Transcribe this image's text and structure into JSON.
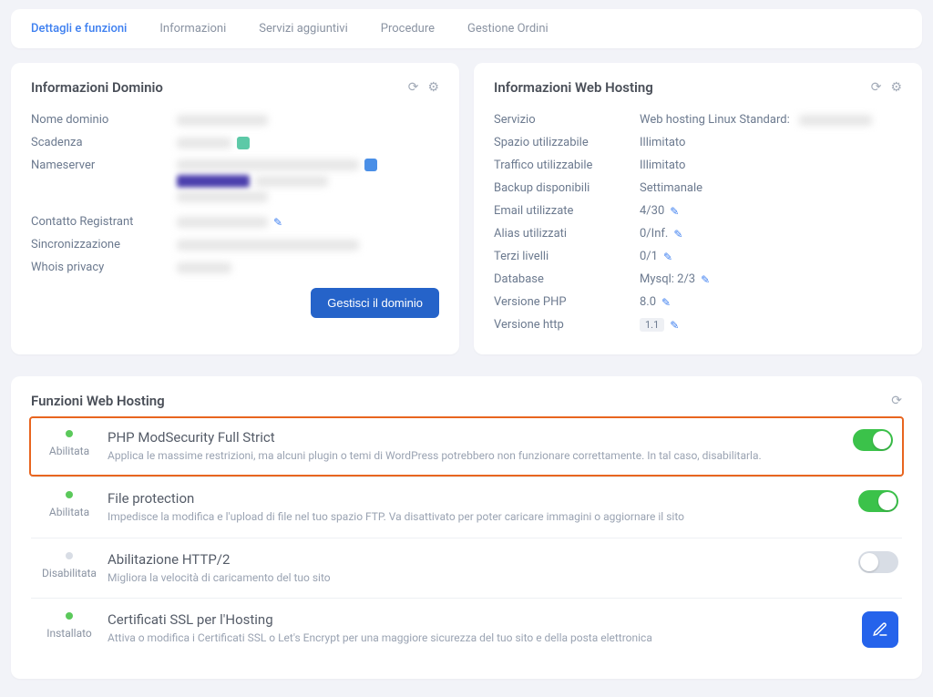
{
  "tabs": {
    "details": "Dettagli e funzioni",
    "info": "Informazioni",
    "addons": "Servizi aggiuntivi",
    "procedures": "Procedure",
    "orders": "Gestione Ordini"
  },
  "domainCard": {
    "title": "Informazioni Dominio",
    "rows": {
      "name_label": "Nome dominio",
      "expiry_label": "Scadenza",
      "ns_label": "Nameserver",
      "contact_label": "Contatto Registrant",
      "sync_label": "Sincronizzazione",
      "whois_label": "Whois privacy"
    },
    "button": "Gestisci il dominio"
  },
  "hostingCard": {
    "title": "Informazioni Web Hosting",
    "rows": {
      "service_label": "Servizio",
      "service_value": "Web hosting Linux Standard:",
      "space_label": "Spazio utilizzabile",
      "space_value": "Illimitato",
      "traffic_label": "Traffico utilizzabile",
      "traffic_value": "Illimitato",
      "backup_label": "Backup disponibili",
      "backup_value": "Settimanale",
      "email_label": "Email utilizzate",
      "email_value": "4/30",
      "alias_label": "Alias utilizzati",
      "alias_value": "0/Inf.",
      "sub_label": "Terzi livelli",
      "sub_value": "0/1",
      "db_label": "Database",
      "db_value": "Mysql: 2/3",
      "php_label": "Versione PHP",
      "php_value": "8.0",
      "http_label": "Versione http",
      "http_value": "1.1"
    }
  },
  "functionsCard": {
    "title": "Funzioni Web Hosting",
    "status_enabled": "Abilitata",
    "status_disabled": "Disabilitata",
    "status_installed": "Installato",
    "features": {
      "modsec": {
        "title": "PHP ModSecurity Full Strict",
        "desc": "Applica le massime restrizioni, ma alcuni plugin o temi di WordPress potrebbero non funzionare correttamente. In tal caso, disabilitarla."
      },
      "fileprot": {
        "title": "File protection",
        "desc": "Impedisce la modifica e l'upload di file nel tuo spazio FTP. Va disattivato per poter caricare immagini o aggiornare il sito"
      },
      "http2": {
        "title": "Abilitazione HTTP/2",
        "desc": "Migliora la velocità di caricamento del tuo sito"
      },
      "ssl": {
        "title": "Certificati SSL per l'Hosting",
        "desc": "Attiva o modifica i Certificati SSL o Let's Encrypt per una maggiore sicurezza del tuo sito e della posta elettronica"
      }
    }
  }
}
